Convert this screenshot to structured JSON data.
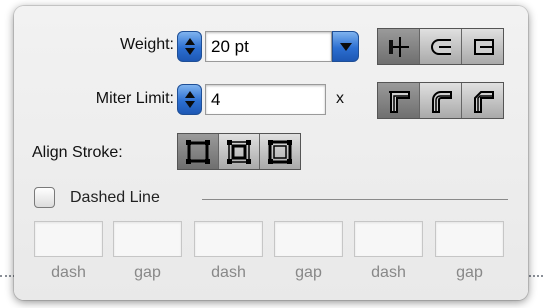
{
  "weight": {
    "label": "Weight:",
    "value": "20 pt"
  },
  "miter_limit": {
    "label": "Miter Limit:",
    "value": "4",
    "unit": "x"
  },
  "cap_buttons": {
    "icons": [
      "butt-cap-icon",
      "round-cap-icon",
      "projecting-cap-icon"
    ],
    "selected_index": 0
  },
  "join_buttons": {
    "icons": [
      "miter-join-icon",
      "round-join-icon",
      "bevel-join-icon"
    ],
    "selected_index": 0
  },
  "align_stroke": {
    "label": "Align Stroke:",
    "icons": [
      "align-center-icon",
      "align-inside-icon",
      "align-outside-icon"
    ],
    "selected_index": 0
  },
  "dashed_line": {
    "label": "Dashed Line",
    "checked": false
  },
  "dash_fields": [
    {
      "label": "dash",
      "value": ""
    },
    {
      "label": "gap",
      "value": ""
    },
    {
      "label": "dash",
      "value": ""
    },
    {
      "label": "gap",
      "value": ""
    },
    {
      "label": "dash",
      "value": ""
    },
    {
      "label": "gap",
      "value": ""
    }
  ],
  "colors": {
    "accent": "#2c6fd1",
    "panel": "#ececec",
    "disabled_text": "#888888"
  }
}
